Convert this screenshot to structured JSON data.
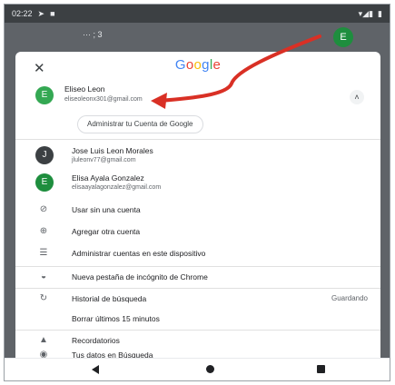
{
  "status": {
    "time": "02:22",
    "signal_text": "▾◢▮"
  },
  "chrome": {
    "tabs_text": "··· ; 3",
    "avatar_letter": "E"
  },
  "sheet": {
    "close_glyph": "✕",
    "logo": [
      "G",
      "o",
      "o",
      "g",
      "l",
      "e"
    ],
    "primary_account": {
      "initial": "E",
      "name": "Eliseo Leon",
      "email": "eliseoleonx301@gmail.com",
      "chevron": "˄"
    },
    "manage_button": "Administrar tu Cuenta de Google",
    "other_accounts": [
      {
        "initial": "J",
        "name": "Jose Luis Leon Morales",
        "email": "jluleonv77@gmail.com",
        "color": "#3c4043"
      },
      {
        "initial": "E",
        "name": "Elisa Ayala Gonzalez",
        "email": "elisaayalagonzalez@gmail.com",
        "color": "#1e8e3e"
      }
    ],
    "menu": [
      {
        "icon": "⊘",
        "label": "Usar sin una cuenta"
      },
      {
        "icon": "⊕",
        "label": "Agregar otra cuenta"
      },
      {
        "icon": "☰",
        "label": "Administrar cuentas en este dispositivo"
      },
      {
        "icon": "◒",
        "label": "Nueva pestaña de incógnito de Chrome"
      },
      {
        "icon": "↻",
        "label": "Historial de búsqueda",
        "aside": "Guardando"
      },
      {
        "icon": "",
        "label": "Borrar últimos 15 minutos"
      },
      {
        "icon": "▲",
        "label": "Recordatorios"
      },
      {
        "icon": "◉",
        "label": "Tus datos en Búsqueda"
      }
    ]
  },
  "colors": {
    "arrow": "#d93025",
    "accent_green": "#34a853"
  }
}
